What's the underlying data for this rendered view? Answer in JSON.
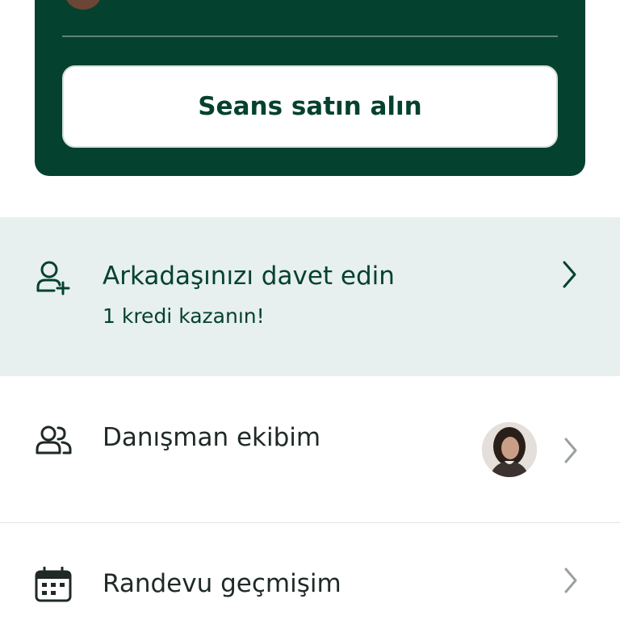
{
  "card": {
    "buy_button_label": "Seans satın alın",
    "background": "#05412f"
  },
  "menu": {
    "invite": {
      "title": "Arkadaşınızı davet edin",
      "subtitle": "1 kredi kazanın!",
      "icon": "add-user-icon",
      "background": "#e7f0ee"
    },
    "team": {
      "label": "Danışman ekibim",
      "icon": "people-icon"
    },
    "history": {
      "label": "Randevu geçmişim",
      "icon": "calendar-icon"
    }
  },
  "colors": {
    "accent": "#05412f",
    "text": "#1f2a27",
    "chevron": "#9aa09e"
  }
}
